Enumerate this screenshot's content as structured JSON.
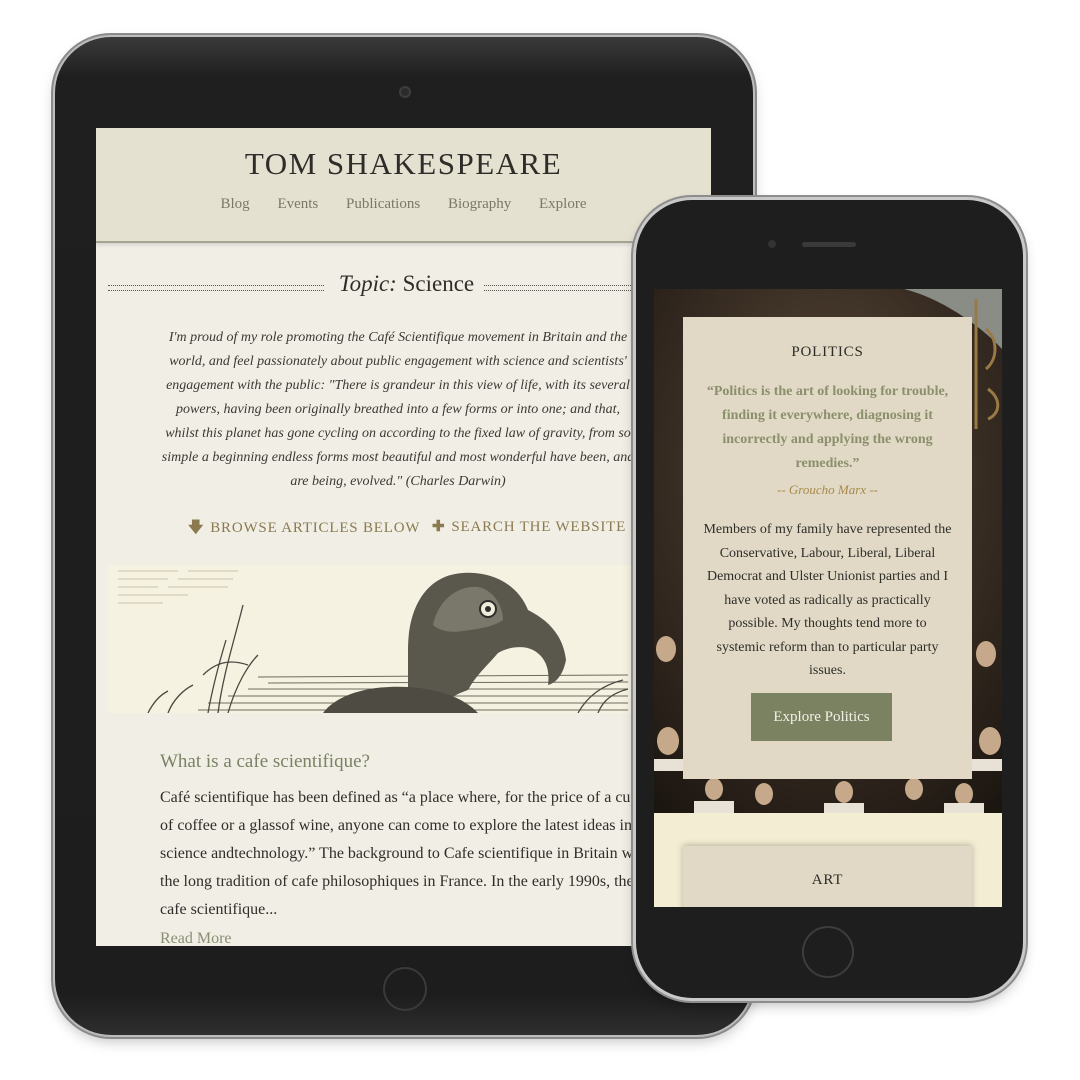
{
  "tablet": {
    "site_title": "TOM SHAKESPEARE",
    "nav": [
      "Blog",
      "Events",
      "Publications",
      "Biography",
      "Explore"
    ],
    "topic_prefix": "Topic:",
    "topic_name": "Science",
    "intro_quote": "I'm proud of my role promoting the Café Scientifique movement in Britain and the world, and feel passionately about public engagement with science and scientists' engagement with the public: \"There is grandeur in this view of life, with its several powers, having been originally breathed into a few forms or into one; and that, whilst this planet has gone cycling on according to the fixed law of gravity, from so simple a beginning endless forms most beautiful and most wonderful have been, and are being, evolved.\" (Charles Darwin)",
    "browse_label": "BROWSE ARTICLES BELOW",
    "search_label": "SEARCH THE WEBSITE",
    "post_title": "What is a cafe scientifique?",
    "post_excerpt": "Café scientifique has been defined as “a place where, for the price of a cup of coffee or a glassof wine, anyone can come to explore the latest ideas in science andtechnology.” The background to Cafe scientifique in Britain was the long tradition of cafe philosophiques in France.  In the early 1990s, the cafe scientifique...",
    "read_more": "Read More"
  },
  "phone": {
    "card_title": "POLITICS",
    "quote": "“Politics is the art of looking for trouble, finding it everywhere, diagnosing it incorrectly and applying the wrong remedies.”",
    "attribution": "-- Groucho Marx --",
    "body": "Members of my family have represented the Conservative, Labour, Liberal, Liberal Democrat and Ulster Unionist parties and I have voted as radically as practically possible. My thoughts tend more to systemic reform than to particular party issues.",
    "button_label": "Explore Politics",
    "next_card_title": "ART"
  },
  "colors": {
    "accent_olive": "#7b8262",
    "accent_gold": "#8b7a4f",
    "header_bg": "#e4e1d0",
    "card_bg": "#e1d9c5"
  },
  "icons": {
    "browse": "arrow-down-icon",
    "search": "plus-icon"
  }
}
